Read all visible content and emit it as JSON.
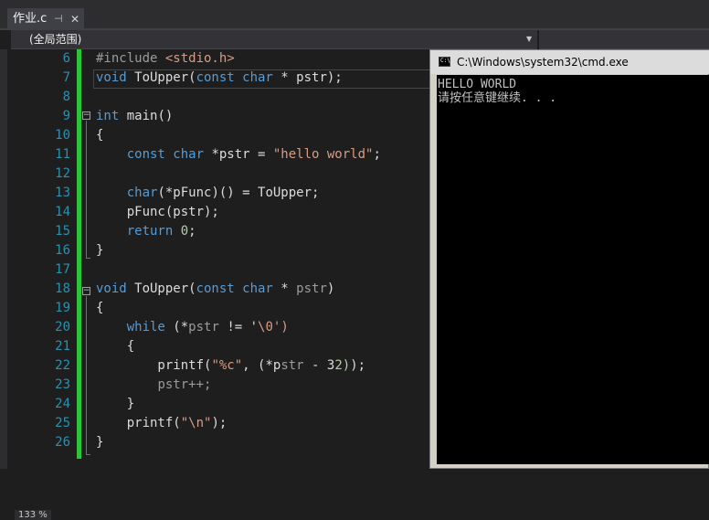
{
  "tab": {
    "title": "作业.c",
    "pin_glyph": "⊣",
    "close_glyph": "✕"
  },
  "scope": {
    "label": "(全局范围)"
  },
  "editor": {
    "line_numbers": [
      "6",
      "7",
      "8",
      "9",
      "10",
      "11",
      "12",
      "13",
      "14",
      "15",
      "16",
      "17",
      "18",
      "19",
      "20",
      "21",
      "22",
      "23",
      "24",
      "25",
      "26"
    ],
    "lines": [
      "#include <stdio.h>",
      "void ToUpper(const char * pstr);",
      "",
      "int main()",
      "{",
      "    const char *pstr = \"hello world\";",
      "",
      "    char(*pFunc)() = ToUpper;",
      "    pFunc(pstr);",
      "    return 0;",
      "}",
      "",
      "void ToUpper(const char * pstr)",
      "{",
      "    while (*pstr != '\\0')",
      "    {",
      "        printf(\"%c\", (*pstr - 32));",
      "        pstr++;",
      "    }",
      "    printf(\"\\n\");",
      "}"
    ],
    "zoom": "133 %"
  },
  "console": {
    "title": "C:\\Windows\\system32\\cmd.exe",
    "icon_text": "C:\\",
    "output": [
      "HELLO WORLD",
      "请按任意键继续. . ."
    ]
  },
  "colors": {
    "editor_background": "#1e1e1e",
    "keyword": "#569cd6",
    "string": "#d69d85",
    "number": "#b5cea8",
    "line_number": "#2b91af",
    "change_bar": "#2bc43a",
    "console_background": "#000000"
  }
}
